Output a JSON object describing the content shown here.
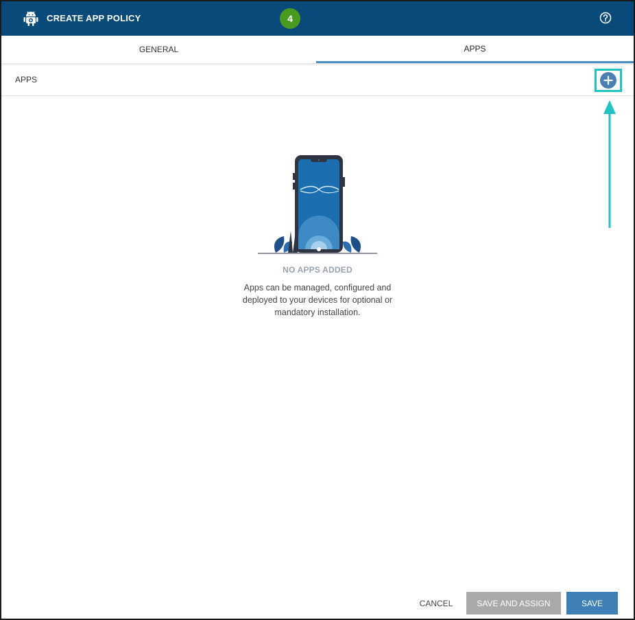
{
  "header": {
    "title": "CREATE APP POLICY",
    "step": "4",
    "logo_icon": "android-icon",
    "help_icon": "help-circle-icon"
  },
  "tabs": [
    {
      "label": "GENERAL",
      "active": false
    },
    {
      "label": "APPS",
      "active": true
    }
  ],
  "section": {
    "label": "APPS",
    "add_icon": "plus-circle-icon"
  },
  "empty_state": {
    "title": "NO APPS ADDED",
    "description": "Apps can be managed, configured and deployed to your devices for optional or mandatory installation."
  },
  "footer": {
    "cancel_label": "CANCEL",
    "save_assign_label": "SAVE AND ASSIGN",
    "save_label": "SAVE"
  },
  "colors": {
    "header_bg": "#0a4a7a",
    "step_badge": "#4a9a1f",
    "tab_underline": "#4a8fc4",
    "add_button": "#4a7fb5",
    "highlight": "#21c4c4",
    "save_button": "#3e7fb8",
    "disabled_button": "#a9a9a9"
  }
}
